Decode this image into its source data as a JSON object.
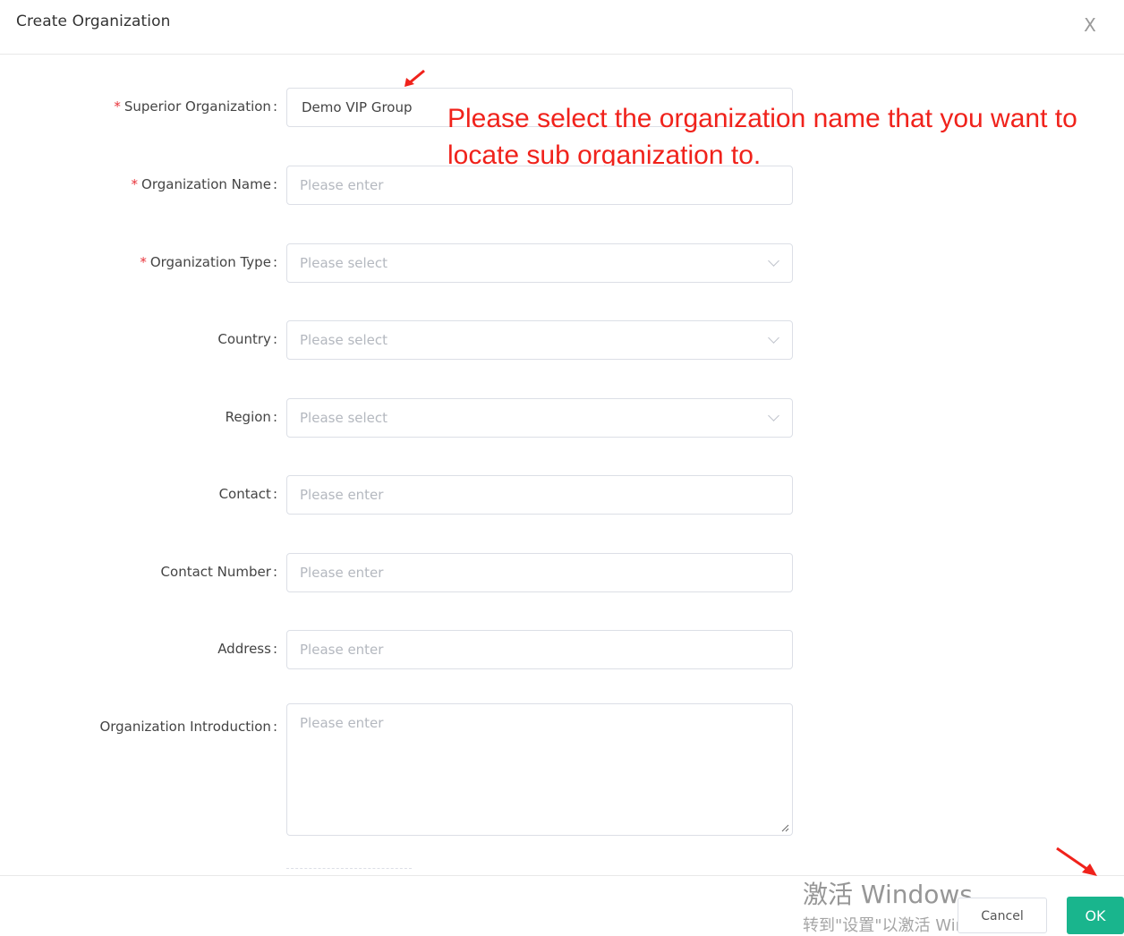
{
  "dialog": {
    "title": "Create Organization",
    "close_glyph": "X"
  },
  "form": {
    "superior_org": {
      "label": "Superior Organization",
      "required": "*",
      "colon": ":",
      "value": "Demo VIP Group"
    },
    "org_name": {
      "label": "Organization Name",
      "required": "*",
      "colon": ":",
      "placeholder": "Please enter"
    },
    "org_type": {
      "label": "Organization Type",
      "required": "*",
      "colon": ":",
      "placeholder": "Please select"
    },
    "country": {
      "label": "Country",
      "colon": ":",
      "placeholder": "Please select"
    },
    "region": {
      "label": "Region",
      "colon": ":",
      "placeholder": "Please select"
    },
    "contact": {
      "label": "Contact",
      "colon": ":",
      "placeholder": "Please enter"
    },
    "contact_number": {
      "label": "Contact Number",
      "colon": ":",
      "placeholder": "Please enter"
    },
    "address": {
      "label": "Address",
      "colon": ":",
      "placeholder": "Please enter"
    },
    "org_intro": {
      "label": "Organization Introduction",
      "colon": ":",
      "placeholder": "Please enter"
    }
  },
  "annotation": {
    "text": "Please select the organization name that you want to locate sub organization to.",
    "color": "#f0221b"
  },
  "footer": {
    "cancel_label": "Cancel",
    "ok_label": "OK"
  },
  "watermark": {
    "line1": "激活 Windows",
    "line2": "转到\"设置\"以激活 Windows。"
  },
  "colors": {
    "primary": "#19b58d",
    "required": "#e8333a",
    "annotation": "#f0221b"
  },
  "icons": [
    "close-icon",
    "chevron-down-icon",
    "resize-grip-icon",
    "annotation-arrow-icon"
  ]
}
